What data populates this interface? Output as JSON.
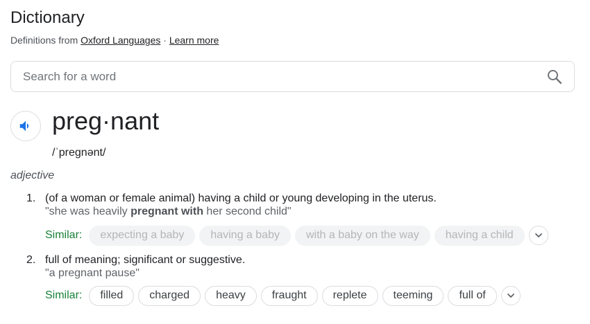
{
  "header": {
    "title": "Dictionary",
    "source_prefix": "Definitions from",
    "source_link": "Oxford Languages",
    "separator": "·",
    "learn_more": "Learn more"
  },
  "search": {
    "placeholder": "Search for a word",
    "value": ""
  },
  "entry": {
    "word": "preg·nant",
    "phonetic": "/ˈpreɡnənt/",
    "part_of_speech": "adjective",
    "similar_label": "Similar:",
    "senses": [
      {
        "number": "1.",
        "definition": "(of a woman or female animal) having a child or young developing in the uterus.",
        "example_start": "\"she was heavily ",
        "example_bold": "pregnant with",
        "example_end": " her second child\"",
        "similar": [
          "expecting a baby",
          "having a baby",
          "with a baby on the way",
          "having a child"
        ]
      },
      {
        "number": "2.",
        "definition": "full of meaning; significant or suggestive.",
        "example": "\"a pregnant pause\"",
        "similar": [
          "filled",
          "charged",
          "heavy",
          "fraught",
          "replete",
          "teeming",
          "full of"
        ]
      }
    ]
  },
  "icons": {
    "speaker": "speaker-icon",
    "search": "search-icon",
    "expand": "chevron-down-icon"
  },
  "colors": {
    "accent_blue": "#1a73e8",
    "similar_green": "#188038",
    "muted_chip_bg": "#f1f3f4"
  }
}
